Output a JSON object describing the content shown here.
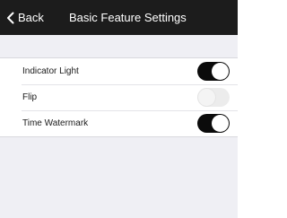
{
  "navbar": {
    "back_label": "Back",
    "title": "Basic Feature Settings"
  },
  "settings": [
    {
      "label": "Indicator Light",
      "enabled": true
    },
    {
      "label": "Flip",
      "enabled": false
    },
    {
      "label": "Time Watermark",
      "enabled": true
    }
  ],
  "colors": {
    "navbar_bg": "#1c1c1c",
    "page_bg": "#efeff4",
    "toggle_on": "#0b0b0b",
    "toggle_off": "#ececec"
  },
  "icons": {
    "back": "chevron-left-icon"
  }
}
